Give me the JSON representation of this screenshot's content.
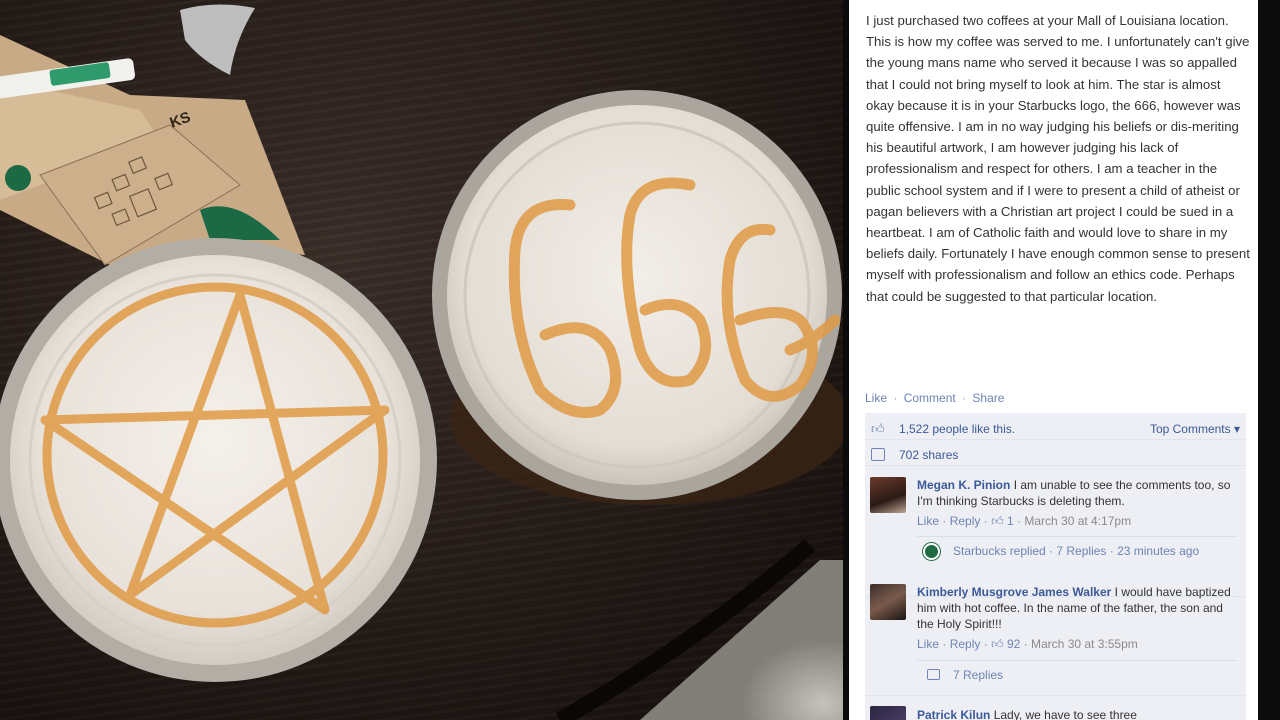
{
  "post": {
    "body": "I just purchased two coffees at your Mall of Louisiana location. This is how my coffee was served to me. I unfortunately can't give the young mans name who served it because I was so appalled that I could not bring myself to look at him. The star is almost okay because it is in your Starbucks logo, the 666, however was quite offensive. I am in no way judging his beliefs or dis-meriting his beautiful artwork, I am however judging his lack of professionalism and respect for others. I am a teacher in the public school system and if I were to present a child of atheist or pagan believers with a Christian art project I could be sued in a heartbeat. I am of Catholic faith and would love to share in my beliefs daily. Fortunately I have enough common sense to present myself with professionalism and follow an ethics code. Perhaps that could be suggested to that particular location."
  },
  "actions": {
    "like": "Like",
    "comment": "Comment",
    "share": "Share",
    "separator": "·"
  },
  "summary": {
    "likes": "1,522 people like this.",
    "top_comments": "Top Comments ▾",
    "shares": "702 shares"
  },
  "comments": [
    {
      "name": "Megan K. Pinion",
      "text": "I am unable to see the comments too, so I'm thinking Starbucks is deleting them.",
      "like": "Like",
      "reply": "Reply",
      "likes": "1",
      "time": "March 30 at 4:17pm",
      "replies_text": "Starbucks replied · 7 Replies · 23 minutes ago"
    },
    {
      "name": "Kimberly Musgrove James Walker",
      "text": "I would have baptized him with hot coffee. In the name of the father, the son and the Holy Spirit!!!",
      "like": "Like",
      "reply": "Reply",
      "likes": "92",
      "time": "March 30 at 3:55pm",
      "replies_text": "7 Replies"
    },
    {
      "name": "Patrick Kilun",
      "text": "Lady, we have to see three"
    }
  ],
  "photo": {
    "cup_sleeve_text": "KS",
    "cup2_drawing": "666"
  },
  "colors": {
    "fb_blue": "#3b5998",
    "fb_link": "#6d84b4",
    "caramel": "#e09a45",
    "table": "#241b17"
  }
}
